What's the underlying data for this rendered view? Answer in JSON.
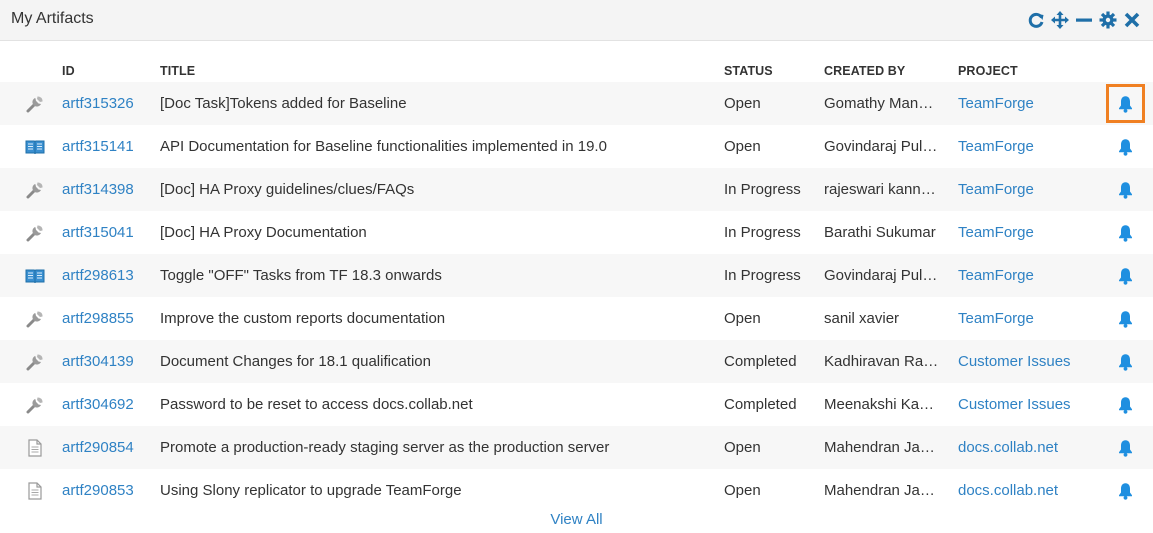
{
  "widget": {
    "title": "My Artifacts",
    "tools": [
      "refresh-icon",
      "move-icon",
      "minimize-icon",
      "settings-icon",
      "close-icon"
    ]
  },
  "columns": {
    "id": "ID",
    "title": "TITLE",
    "status": "STATUS",
    "created_by": "CREATED BY",
    "project": "PROJECT"
  },
  "rows": [
    {
      "icon": "wrench-icon",
      "id": "artf315326",
      "title": "[Doc Task]Tokens added for Baseline",
      "status": "Open",
      "created_by": "Gomathy Man…",
      "project": "TeamForge"
    },
    {
      "icon": "book-icon",
      "id": "artf315141",
      "title": "API Documentation for Baseline functionalities implemented in 19.0",
      "status": "Open",
      "created_by": "Govindaraj Pul…",
      "project": "TeamForge"
    },
    {
      "icon": "wrench-icon",
      "id": "artf314398",
      "title": "[Doc] HA Proxy guidelines/clues/FAQs",
      "status": "In Progress",
      "created_by": "rajeswari kann…",
      "project": "TeamForge"
    },
    {
      "icon": "wrench-icon",
      "id": "artf315041",
      "title": "[Doc] HA Proxy Documentation",
      "status": "In Progress",
      "created_by": "Barathi Sukumar",
      "project": "TeamForge"
    },
    {
      "icon": "book-icon",
      "id": "artf298613",
      "title": "Toggle \"OFF\" Tasks from TF 18.3 onwards",
      "status": "In Progress",
      "created_by": "Govindaraj Pul…",
      "project": "TeamForge"
    },
    {
      "icon": "wrench-icon",
      "id": "artf298855",
      "title": "Improve the custom reports documentation",
      "status": "Open",
      "created_by": "sanil xavier",
      "project": "TeamForge"
    },
    {
      "icon": "wrench-icon",
      "id": "artf304139",
      "title": "Document Changes for 18.1 qualification",
      "status": "Completed",
      "created_by": "Kadhiravan Ra…",
      "project": "Customer Issues"
    },
    {
      "icon": "wrench-icon",
      "id": "artf304692",
      "title": "Password to be reset to access docs.collab.net",
      "status": "Completed",
      "created_by": "Meenakshi Ka…",
      "project": "Customer Issues"
    },
    {
      "icon": "document-icon",
      "id": "artf290854",
      "title": "Promote a production-ready staging server as the production server",
      "status": "Open",
      "created_by": "Mahendran Ja…",
      "project": "docs.collab.net"
    },
    {
      "icon": "document-icon",
      "id": "artf290853",
      "title": "Using Slony replicator to upgrade TeamForge",
      "status": "Open",
      "created_by": "Mahendran Ja…",
      "project": "docs.collab.net"
    }
  ],
  "footer": {
    "view_all": "View All"
  },
  "colors": {
    "link": "#2f82c4",
    "highlight": "#f08022",
    "icon": "#1f6fa8"
  }
}
